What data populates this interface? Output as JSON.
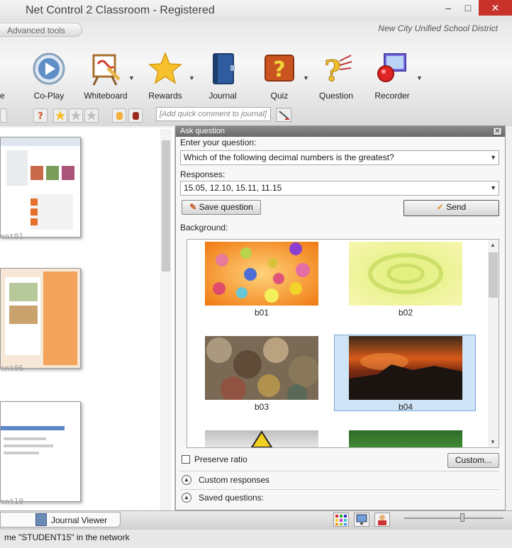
{
  "window": {
    "title": "Net Control 2 Classroom - Registered",
    "minimize": "–",
    "maximize": "□",
    "close": "✕"
  },
  "header": {
    "advanced_tab": "Advanced tools",
    "district": "New City Unified School District",
    "tools": [
      {
        "label": "Co-Play",
        "icon": "play-icon"
      },
      {
        "label": "Whiteboard",
        "icon": "whiteboard-icon"
      },
      {
        "label": "Rewards",
        "icon": "star-icon"
      },
      {
        "label": "Journal",
        "icon": "journal-icon"
      },
      {
        "label": "Quiz",
        "icon": "quiz-icon"
      },
      {
        "label": "Question",
        "icon": "question-icon"
      },
      {
        "label": "Recorder",
        "icon": "recorder-icon"
      }
    ],
    "first_tool_partial": "e",
    "quick_comment_placeholder": "[Add quick comment to journal]"
  },
  "left_pane": {
    "thumbnails": [
      {
        "caption": "ent01"
      },
      {
        "caption": "ent06"
      },
      {
        "caption": "ent10"
      }
    ]
  },
  "dialog": {
    "title": "Ask question",
    "close": "✕",
    "question_label": "Enter your question:",
    "question_value": "Which of the following decimal numbers is the greatest?",
    "responses_label": "Responses:",
    "responses_value": "15.05, 12.10, 15.11, 11.15",
    "save_button": "Save question",
    "send_button": "Send",
    "background_label": "Background:",
    "backgrounds": [
      {
        "caption": "b01"
      },
      {
        "caption": "b02"
      },
      {
        "caption": "b03"
      },
      {
        "caption": "b04",
        "selected": true
      }
    ],
    "preserve_ratio_label": "Preserve ratio",
    "preserve_ratio_checked": false,
    "custom_button": "Custom...",
    "custom_responses_label": "Custom responses",
    "saved_questions_label": "Saved questions:"
  },
  "bottom": {
    "journal_tab": "Journal Viewer",
    "status": "me \"STUDENT15\" in the network"
  },
  "colors": {
    "close_button": "#c7332b",
    "selection": "#cfe4f7",
    "dialog_title": "#7a7a7a"
  }
}
